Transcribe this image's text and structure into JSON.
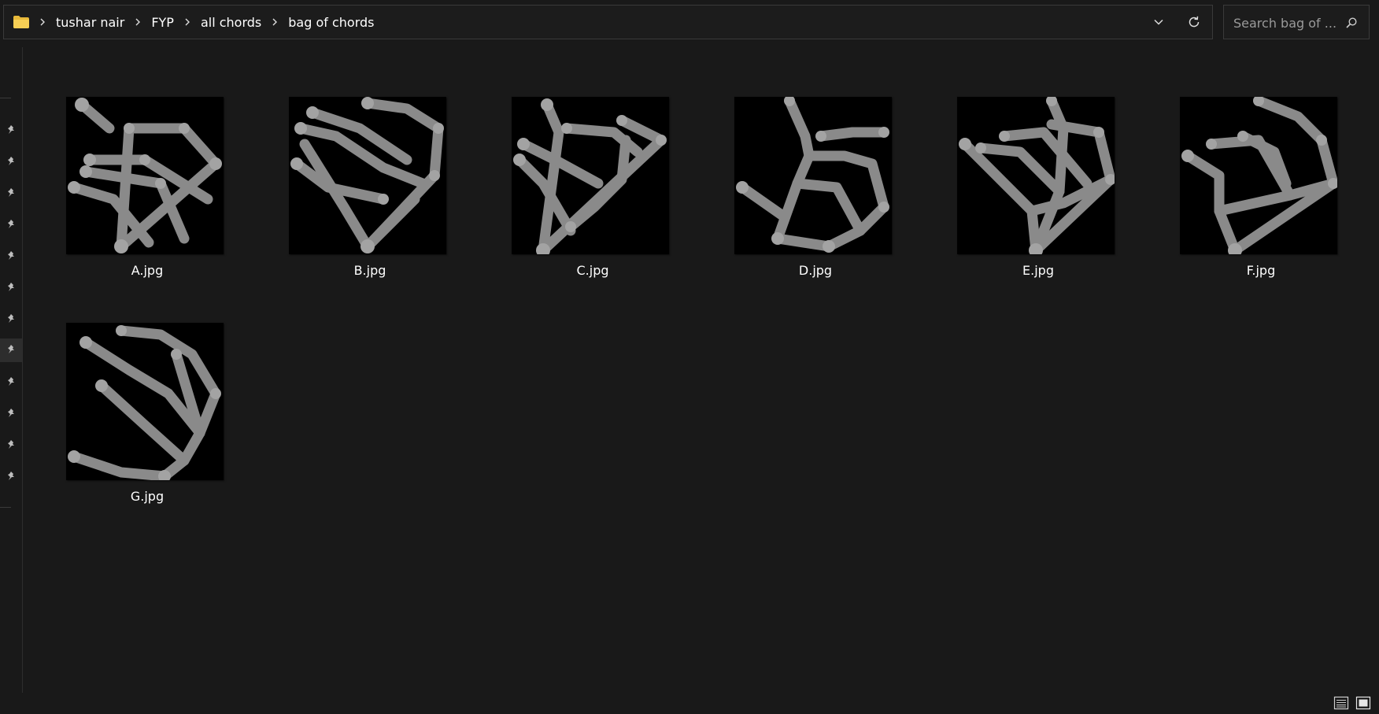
{
  "address_bar": {
    "breadcrumb": [
      "tushar nair",
      "FYP",
      "all chords",
      "bag of chords"
    ],
    "icons": {
      "folder": "folder-icon",
      "separator": "chevron-right-icon",
      "history": "chevron-down-icon",
      "refresh": "refresh-icon"
    }
  },
  "search": {
    "placeholder": "Search bag of ...",
    "icon": "search-icon"
  },
  "nav_pane": {
    "pin_icon": "pin-icon",
    "pin_count": 12,
    "selected_index": 7
  },
  "files": [
    {
      "name": "A.jpg"
    },
    {
      "name": "B.jpg"
    },
    {
      "name": "C.jpg"
    },
    {
      "name": "D.jpg"
    },
    {
      "name": "E.jpg"
    },
    {
      "name": "F.jpg"
    },
    {
      "name": "G.jpg"
    }
  ],
  "status_bar": {
    "view_buttons": [
      "details-view-icon",
      "large-icons-view-icon"
    ]
  },
  "colors": {
    "background": "#191919",
    "border": "#3a3a3a",
    "folder": "#f2c94c",
    "text": "#ffffff",
    "thumb_stroke": "#8a8a8a"
  }
}
